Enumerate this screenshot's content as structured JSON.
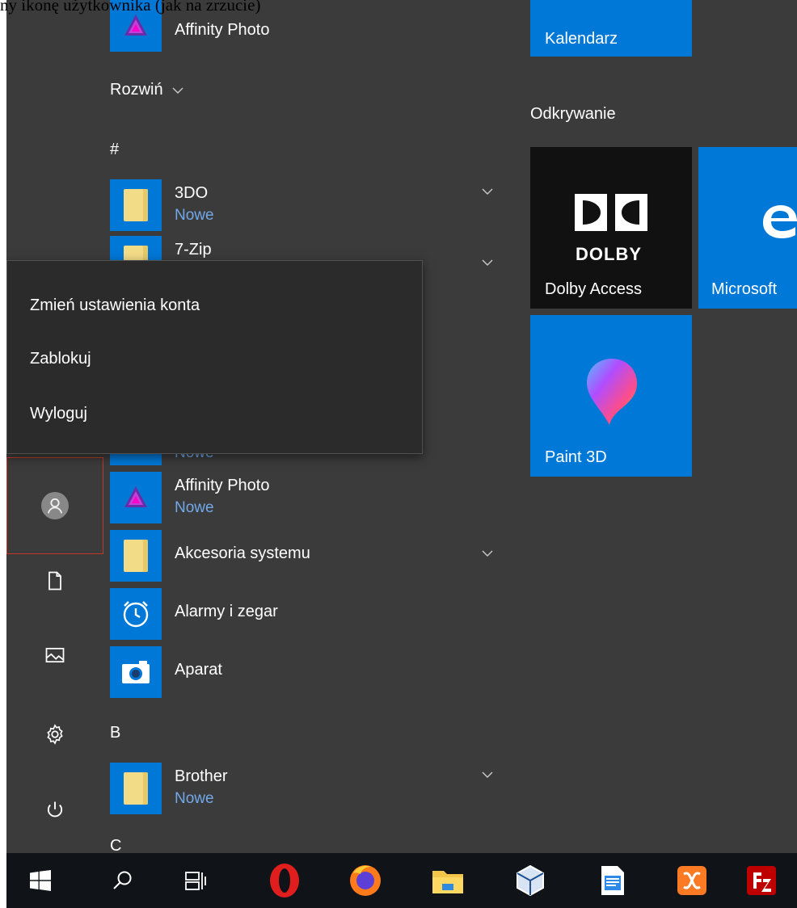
{
  "caption": "ny ikonę użytkownika (jak na zrzucie)",
  "apps_list": {
    "expand_label": "Rozwiń",
    "section_hash": "#",
    "section_b": "B",
    "section_c": "C",
    "top_app": {
      "name": "Affinity Photo"
    },
    "app_3do": {
      "name": "3DO",
      "sub": "Nowe"
    },
    "app_7zip": {
      "name": "7-Zip"
    },
    "new_partial": "Nowe",
    "app_affinity": {
      "name": "Affinity Photo",
      "sub": "Nowe"
    },
    "app_akcesoria": {
      "name": "Akcesoria systemu"
    },
    "app_alarmy": {
      "name": "Alarmy i zegar"
    },
    "app_aparat": {
      "name": "Aparat"
    },
    "app_brother": {
      "name": "Brother",
      "sub": "Nowe"
    }
  },
  "account_menu": {
    "items": [
      "Zmień ustawienia konta",
      "Zablokuj",
      "Wyloguj"
    ]
  },
  "tiles": {
    "calendar_label": "Kalendarz",
    "group_discover": "Odkrywanie",
    "dolby_logo_text": "DOLBY",
    "dolby_label": "Dolby Access",
    "edge_label": "Microsoft",
    "paint3d_label": "Paint 3D"
  },
  "rail_icons": [
    "user-avatar-icon",
    "document-icon",
    "pictures-icon",
    "settings-icon",
    "power-icon"
  ],
  "taskbar_icons": [
    "windows-start-icon",
    "search-icon",
    "task-view-icon",
    "opera-icon",
    "firefox-icon",
    "file-explorer-icon",
    "virtualbox-icon",
    "document-writer-icon",
    "xampp-icon",
    "filezilla-icon"
  ],
  "colors": {
    "accent": "#0078d7",
    "start_bg": "#3b3b3b",
    "new_label": "#72a8e8",
    "highlight_border": "#c0392b"
  }
}
